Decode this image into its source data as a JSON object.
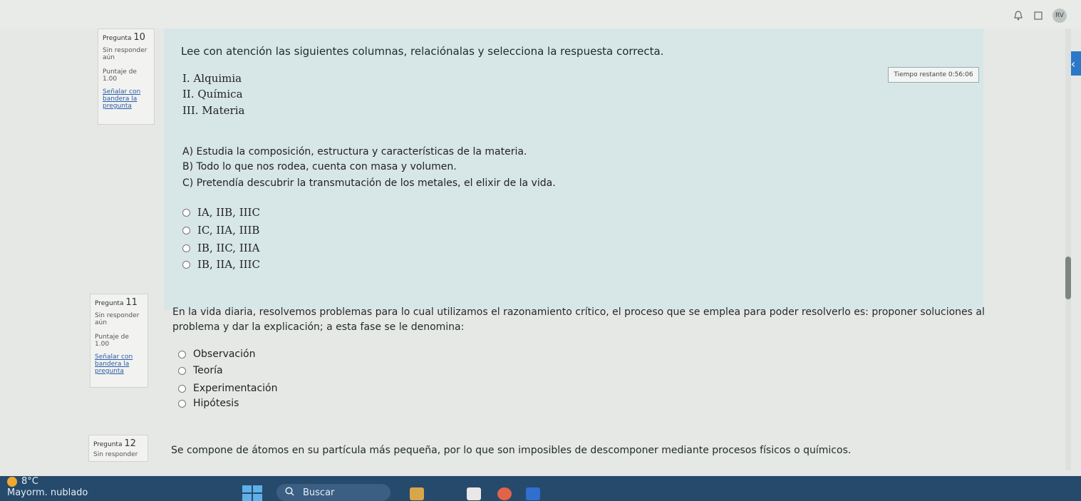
{
  "questions": [
    {
      "number_label": "Pregunta",
      "number": "10",
      "status": "Sin responder aún",
      "score": "Puntaje de 1.00",
      "flag": "Señalar con bandera la pregunta",
      "prompt": "Lee con atención las siguientes columnas, relaciónalas y selecciona la respuesta correcta.",
      "column_items": [
        "I. Alquimia",
        "II. Química",
        "III. Materia"
      ],
      "statements": [
        "A) Estudia la composición, estructura y características de la materia.",
        "B) Todo lo que nos rodea, cuenta con masa y volumen.",
        "C) Pretendía descubrir la transmutación de los metales, el elixir de la vida."
      ],
      "options": [
        "IA, IIB, IIIC",
        "IC, IIA, IIIB",
        "IB, IIC, IIIA",
        "IB, IIA, IIIC"
      ]
    },
    {
      "number_label": "Pregunta",
      "number": "11",
      "status": "Sin responder aún",
      "score": "Puntaje de 1.00",
      "flag": "Señalar con bandera la pregunta",
      "prompt_line1": "En la vida diaria, resolvemos problemas para lo cual utilizamos el razonamiento crítico, el proceso que se emplea para poder resolverlo es: proponer soluciones al",
      "prompt_line2": "problema y dar la explicación; a esta fase se le denomina:",
      "options": [
        "Observación",
        "Teoría",
        "Experimentación",
        "Hipótesis"
      ]
    },
    {
      "number_label": "Pregunta",
      "number": "12",
      "status": "Sin responder",
      "prompt": "Se compone de átomos en su partícula más pequeña, por lo que son imposibles de descomponer mediante procesos físicos o químicos."
    }
  ],
  "timer": "Tiempo restante 0:56:06",
  "taskbar": {
    "temperature": "8°C",
    "weather": "Mayorm. nublado",
    "search": "Buscar"
  },
  "icons": [
    "bell-icon",
    "window-icon",
    "avatar",
    "chevron-left-icon",
    "windows-logo-icon",
    "search-icon",
    "weather-icon"
  ]
}
